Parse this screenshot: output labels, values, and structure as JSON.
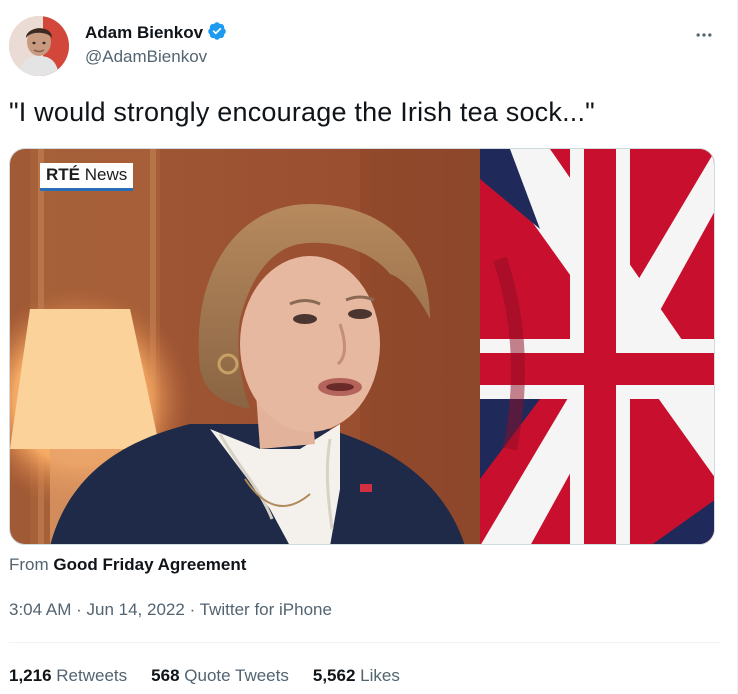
{
  "author": {
    "display_name": "Adam Bienkov",
    "handle": "@AdamBienkov",
    "verified_icon": "verified-badge-icon",
    "verified_color": "#1d9bf0"
  },
  "more_icon": "more-options-icon",
  "tweet": {
    "text": "\"I would strongly encourage the Irish tea sock...\""
  },
  "media": {
    "watermark_brand": "RTÉ",
    "watermark_label": "News"
  },
  "source": {
    "prefix": "From",
    "name": "Good Friday Agreement"
  },
  "meta": {
    "time": "3:04 AM",
    "separator": "·",
    "date": "Jun 14, 2022",
    "client": "Twitter for iPhone"
  },
  "stats": {
    "retweets_count": "1,216",
    "retweets_label": "Retweets",
    "quotes_count": "568",
    "quotes_label": "Quote Tweets",
    "likes_count": "5,562",
    "likes_label": "Likes"
  },
  "colors": {
    "text_primary": "#0f1419",
    "text_secondary": "#536471",
    "divider": "#eff3f4"
  }
}
